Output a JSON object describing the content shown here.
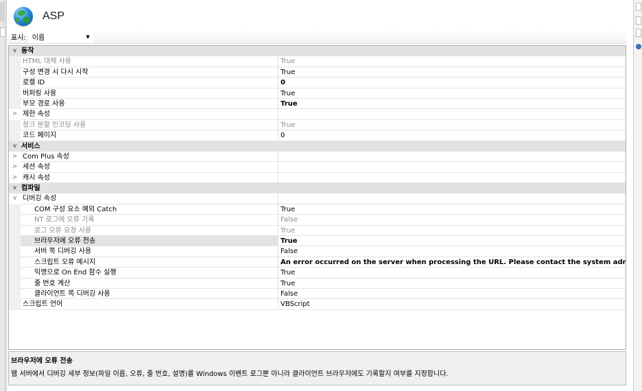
{
  "app": {
    "title": "ASP",
    "globe_icon": "globe-icon"
  },
  "view": {
    "label": "표시:",
    "selected": "이름"
  },
  "rows": [
    {
      "type": "cat",
      "expander": "v",
      "name": "동작"
    },
    {
      "type": "prop",
      "name": "HTML 대체 사용",
      "value": "True",
      "disabled": true
    },
    {
      "type": "prop",
      "name": "구성 변경 시 다시 시작",
      "value": "True"
    },
    {
      "type": "prop",
      "name": "로켈 ID",
      "value": "0",
      "bold": true
    },
    {
      "type": "prop",
      "name": "버퍼링 사용",
      "value": "True"
    },
    {
      "type": "prop",
      "name": "부모 경로 사용",
      "value": "True",
      "bold": true
    },
    {
      "type": "group",
      "expander": ">",
      "name": "제한 속성",
      "value": ""
    },
    {
      "type": "prop",
      "name": "청크 분할 인코딩 사용",
      "value": "True",
      "disabled": true
    },
    {
      "type": "prop",
      "name": "코드 페이지",
      "value": "0"
    },
    {
      "type": "cat",
      "expander": "v",
      "name": "서비스"
    },
    {
      "type": "group",
      "expander": ">",
      "name": "Com Plus 속성",
      "value": ""
    },
    {
      "type": "group",
      "expander": ">",
      "name": "세션 속성",
      "value": ""
    },
    {
      "type": "group",
      "expander": ">",
      "name": "캐시 속성",
      "value": ""
    },
    {
      "type": "cat",
      "expander": "v",
      "name": "컴파일"
    },
    {
      "type": "group",
      "expander": "v",
      "name": "디버깅 속성",
      "value": ""
    },
    {
      "type": "sub",
      "name": "COM 구성 요소 예외 Catch",
      "value": "True"
    },
    {
      "type": "sub",
      "name": "NT 로그에 오류 기록",
      "value": "False",
      "disabled": true
    },
    {
      "type": "sub",
      "name": "로그 오류 요청 사용",
      "value": "True",
      "disabled": true
    },
    {
      "type": "sub",
      "name": "브라우저에 오류 전송",
      "value": "True",
      "bold": true,
      "selected": true
    },
    {
      "type": "sub",
      "name": "서버 쪽 디버깅 사용",
      "value": "False"
    },
    {
      "type": "sub",
      "name": "스크립트 오류 메시지",
      "value": "An error occurred on the server when processing the URL. Please contact the system administrator. <p/>",
      "bold": true
    },
    {
      "type": "sub",
      "name": "익명으로 On End 함수 실행",
      "value": "True"
    },
    {
      "type": "sub",
      "name": "줄 번호 계산",
      "value": "True"
    },
    {
      "type": "sub",
      "name": "클라이언트 쪽 디버깅 사용",
      "value": "False"
    },
    {
      "type": "prop",
      "name": "스크립트 언어",
      "value": "VBScript"
    }
  ],
  "description": {
    "title": "브라우저에 오류 전송",
    "text": "웹 서버에서 디버깅 세부 정보(파일 이름, 오류, 줄 번호, 설명)를 Windows 이벤트 로그뿐 아니라 클라이언트 브라우저에도 기록할지 여부를 지정합니다."
  }
}
